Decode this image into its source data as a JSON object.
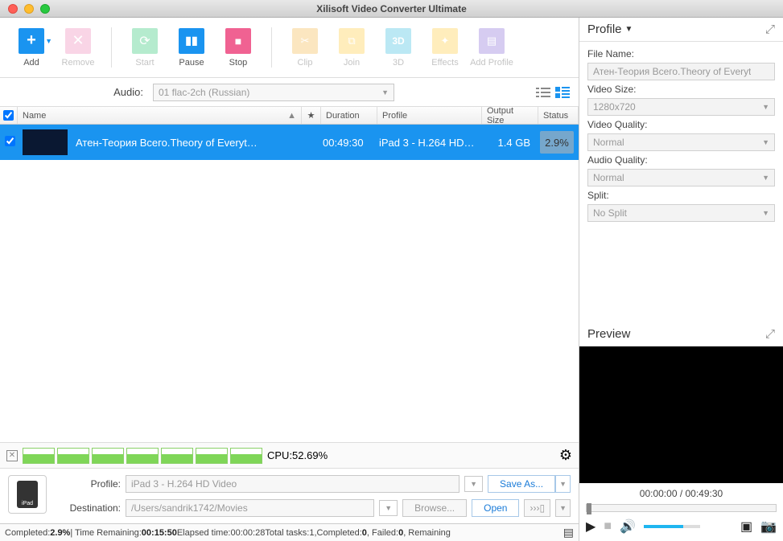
{
  "window": {
    "title": "Xilisoft Video Converter Ultimate"
  },
  "toolbar": {
    "add": "Add",
    "remove": "Remove",
    "start": "Start",
    "pause": "Pause",
    "stop": "Stop",
    "clip": "Clip",
    "join": "Join",
    "threeD": "3D",
    "effects": "Effects",
    "addProfile": "Add Profile"
  },
  "audio": {
    "label": "Audio:",
    "value": "01 flac-2ch (Russian)"
  },
  "columns": {
    "name": "Name",
    "duration": "Duration",
    "profile": "Profile",
    "outputSize": "Output Size",
    "status": "Status"
  },
  "rows": [
    {
      "checked": true,
      "name": "Атен-Теория Всего.Theory of Everyt…",
      "duration": "00:49:30",
      "profile": "iPad 3 - H.264 HD…",
      "size": "1.4 GB",
      "status": "2.9%"
    }
  ],
  "cpu": {
    "label": "CPU:52.69%"
  },
  "bottom": {
    "profileLabel": "Profile:",
    "profileValue": "iPad 3 - H.264 HD Video",
    "saveAs": "Save As...",
    "destLabel": "Destination:",
    "destValue": "/Users/sandrik1742/Movies",
    "browse": "Browse...",
    "open": "Open",
    "iconText": "iPad"
  },
  "statusBar": {
    "completedLbl": "Completed: ",
    "completedPct": "2.9%",
    "timeRemLbl": " | Time Remaining: ",
    "timeRem": "00:15:50",
    "elapsedLbl": " Elapsed time: ",
    "elapsed": "00:00:28",
    "tasksLbl": " Total tasks: ",
    "tasks": "1",
    "compLbl": " ,Completed: ",
    "comp": "0",
    "failLbl": ", Failed: ",
    "fail": "0",
    "remLbl": ", Remaining"
  },
  "profilePanel": {
    "title": "Profile",
    "fileNameLbl": "File Name:",
    "fileName": "Атен-Теория Всего.Theory of Everyt",
    "videoSizeLbl": "Video Size:",
    "videoSize": "1280x720",
    "videoQualLbl": "Video Quality:",
    "videoQual": "Normal",
    "audioQualLbl": "Audio Quality:",
    "audioQual": "Normal",
    "splitLbl": "Split:",
    "split": "No Split"
  },
  "preview": {
    "title": "Preview",
    "time": "00:00:00 / 00:49:30"
  }
}
